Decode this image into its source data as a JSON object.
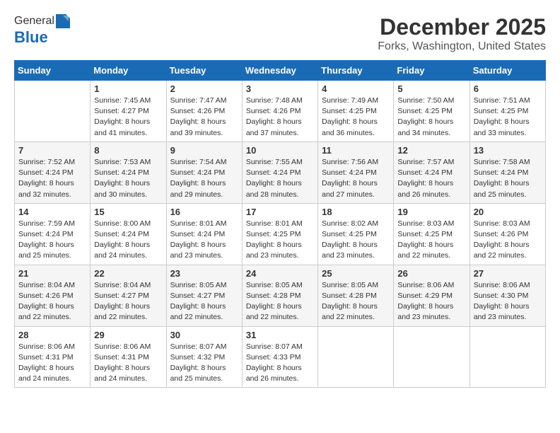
{
  "logo": {
    "general": "General",
    "blue": "Blue"
  },
  "title": "December 2025",
  "location": "Forks, Washington, United States",
  "days_of_week": [
    "Sunday",
    "Monday",
    "Tuesday",
    "Wednesday",
    "Thursday",
    "Friday",
    "Saturday"
  ],
  "weeks": [
    [
      {
        "day": "",
        "info": ""
      },
      {
        "day": "1",
        "info": "Sunrise: 7:45 AM\nSunset: 4:27 PM\nDaylight: 8 hours\nand 41 minutes."
      },
      {
        "day": "2",
        "info": "Sunrise: 7:47 AM\nSunset: 4:26 PM\nDaylight: 8 hours\nand 39 minutes."
      },
      {
        "day": "3",
        "info": "Sunrise: 7:48 AM\nSunset: 4:26 PM\nDaylight: 8 hours\nand 37 minutes."
      },
      {
        "day": "4",
        "info": "Sunrise: 7:49 AM\nSunset: 4:25 PM\nDaylight: 8 hours\nand 36 minutes."
      },
      {
        "day": "5",
        "info": "Sunrise: 7:50 AM\nSunset: 4:25 PM\nDaylight: 8 hours\nand 34 minutes."
      },
      {
        "day": "6",
        "info": "Sunrise: 7:51 AM\nSunset: 4:25 PM\nDaylight: 8 hours\nand 33 minutes."
      }
    ],
    [
      {
        "day": "7",
        "info": "Sunrise: 7:52 AM\nSunset: 4:24 PM\nDaylight: 8 hours\nand 32 minutes."
      },
      {
        "day": "8",
        "info": "Sunrise: 7:53 AM\nSunset: 4:24 PM\nDaylight: 8 hours\nand 30 minutes."
      },
      {
        "day": "9",
        "info": "Sunrise: 7:54 AM\nSunset: 4:24 PM\nDaylight: 8 hours\nand 29 minutes."
      },
      {
        "day": "10",
        "info": "Sunrise: 7:55 AM\nSunset: 4:24 PM\nDaylight: 8 hours\nand 28 minutes."
      },
      {
        "day": "11",
        "info": "Sunrise: 7:56 AM\nSunset: 4:24 PM\nDaylight: 8 hours\nand 27 minutes."
      },
      {
        "day": "12",
        "info": "Sunrise: 7:57 AM\nSunset: 4:24 PM\nDaylight: 8 hours\nand 26 minutes."
      },
      {
        "day": "13",
        "info": "Sunrise: 7:58 AM\nSunset: 4:24 PM\nDaylight: 8 hours\nand 25 minutes."
      }
    ],
    [
      {
        "day": "14",
        "info": "Sunrise: 7:59 AM\nSunset: 4:24 PM\nDaylight: 8 hours\nand 25 minutes."
      },
      {
        "day": "15",
        "info": "Sunrise: 8:00 AM\nSunset: 4:24 PM\nDaylight: 8 hours\nand 24 minutes."
      },
      {
        "day": "16",
        "info": "Sunrise: 8:01 AM\nSunset: 4:24 PM\nDaylight: 8 hours\nand 23 minutes."
      },
      {
        "day": "17",
        "info": "Sunrise: 8:01 AM\nSunset: 4:25 PM\nDaylight: 8 hours\nand 23 minutes."
      },
      {
        "day": "18",
        "info": "Sunrise: 8:02 AM\nSunset: 4:25 PM\nDaylight: 8 hours\nand 23 minutes."
      },
      {
        "day": "19",
        "info": "Sunrise: 8:03 AM\nSunset: 4:25 PM\nDaylight: 8 hours\nand 22 minutes."
      },
      {
        "day": "20",
        "info": "Sunrise: 8:03 AM\nSunset: 4:26 PM\nDaylight: 8 hours\nand 22 minutes."
      }
    ],
    [
      {
        "day": "21",
        "info": "Sunrise: 8:04 AM\nSunset: 4:26 PM\nDaylight: 8 hours\nand 22 minutes."
      },
      {
        "day": "22",
        "info": "Sunrise: 8:04 AM\nSunset: 4:27 PM\nDaylight: 8 hours\nand 22 minutes."
      },
      {
        "day": "23",
        "info": "Sunrise: 8:05 AM\nSunset: 4:27 PM\nDaylight: 8 hours\nand 22 minutes."
      },
      {
        "day": "24",
        "info": "Sunrise: 8:05 AM\nSunset: 4:28 PM\nDaylight: 8 hours\nand 22 minutes."
      },
      {
        "day": "25",
        "info": "Sunrise: 8:05 AM\nSunset: 4:28 PM\nDaylight: 8 hours\nand 22 minutes."
      },
      {
        "day": "26",
        "info": "Sunrise: 8:06 AM\nSunset: 4:29 PM\nDaylight: 8 hours\nand 23 minutes."
      },
      {
        "day": "27",
        "info": "Sunrise: 8:06 AM\nSunset: 4:30 PM\nDaylight: 8 hours\nand 23 minutes."
      }
    ],
    [
      {
        "day": "28",
        "info": "Sunrise: 8:06 AM\nSunset: 4:31 PM\nDaylight: 8 hours\nand 24 minutes."
      },
      {
        "day": "29",
        "info": "Sunrise: 8:06 AM\nSunset: 4:31 PM\nDaylight: 8 hours\nand 24 minutes."
      },
      {
        "day": "30",
        "info": "Sunrise: 8:07 AM\nSunset: 4:32 PM\nDaylight: 8 hours\nand 25 minutes."
      },
      {
        "day": "31",
        "info": "Sunrise: 8:07 AM\nSunset: 4:33 PM\nDaylight: 8 hours\nand 26 minutes."
      },
      {
        "day": "",
        "info": ""
      },
      {
        "day": "",
        "info": ""
      },
      {
        "day": "",
        "info": ""
      }
    ]
  ]
}
